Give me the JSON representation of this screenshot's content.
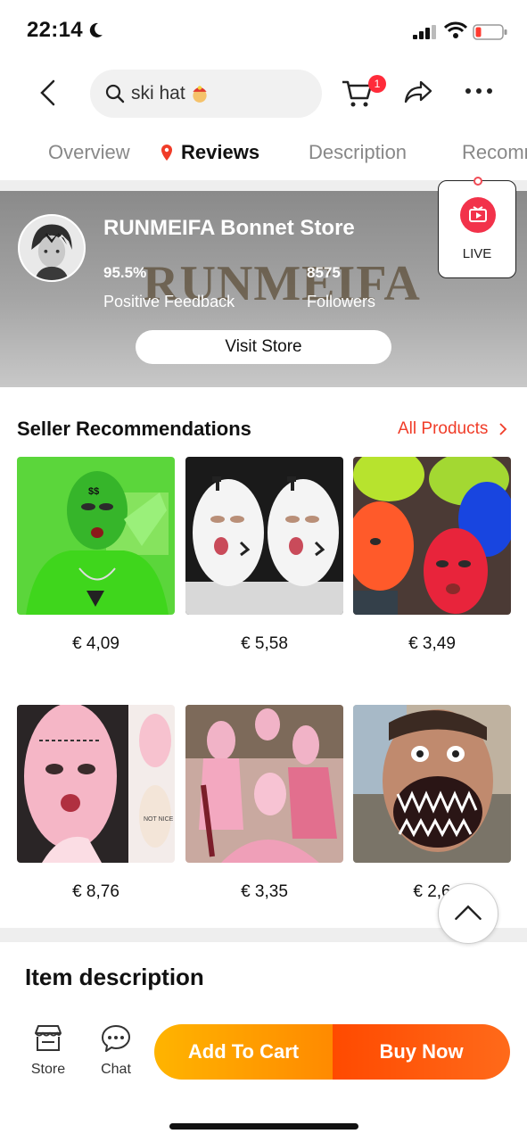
{
  "status": {
    "time": "22:14"
  },
  "search": {
    "query": "ski hat"
  },
  "cart": {
    "badge": "1"
  },
  "tabs": [
    {
      "label": "Overview"
    },
    {
      "label": "Reviews"
    },
    {
      "label": "Description"
    },
    {
      "label": "Recomm"
    }
  ],
  "live": {
    "label": "LIVE"
  },
  "store": {
    "name": "RUNMEIFA Bonnet Store",
    "watermark": "RUNMEIFA",
    "positive_feedback_value": "95.5%",
    "positive_feedback_label": "Positive Feedback",
    "followers_value": "8575",
    "followers_label": "Followers",
    "visit_label": "Visit Store"
  },
  "recommendations": {
    "title": "Seller Recommendations",
    "all_products_label": "All Products",
    "products": [
      {
        "price": "€ 4,09"
      },
      {
        "price": "€ 5,58"
      },
      {
        "price": "€ 3,49"
      },
      {
        "price": "€ 8,76"
      },
      {
        "price": "€ 3,35"
      },
      {
        "price": "€ 2,6"
      }
    ]
  },
  "item_description": {
    "title": "Item description"
  },
  "bottom_bar": {
    "store_label": "Store",
    "chat_label": "Chat",
    "add_to_cart_label": "Add To Cart",
    "buy_now_label": "Buy Now"
  },
  "colors": {
    "accent_red": "#f03c28",
    "cart_orange": "#ffb400",
    "buy_orange": "#ff4a00"
  }
}
